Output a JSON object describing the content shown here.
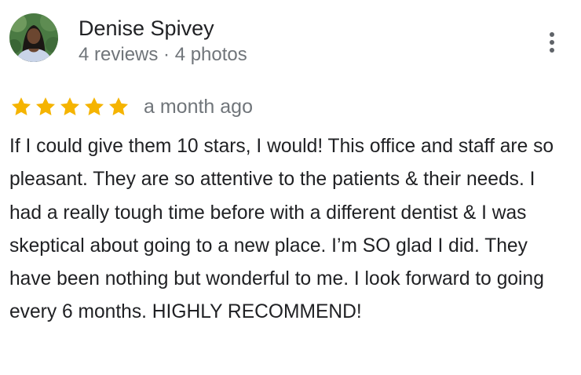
{
  "reviewer": {
    "name": "Denise Spivey",
    "stats": "4 reviews · 4 photos",
    "avatar_icon": "avatar-photo"
  },
  "menu": {
    "icon": "more-vertical-icon"
  },
  "rating": {
    "stars": 5,
    "max_stars": 5,
    "star_color": "#f5b400",
    "date": "a month ago"
  },
  "review": {
    "text": "If I could give them 10 stars, I would! This office and staff are so pleasant. They are so attentive to the patients & their needs. I had a really tough time before with a different dentist & I was skeptical about going to a new place. I’m SO glad I did. They have been nothing but wonderful to me. I look forward to going every 6 months. HIGHLY RECOMMEND!"
  },
  "colors": {
    "primary_text": "#202124",
    "secondary_text": "#70757a"
  }
}
